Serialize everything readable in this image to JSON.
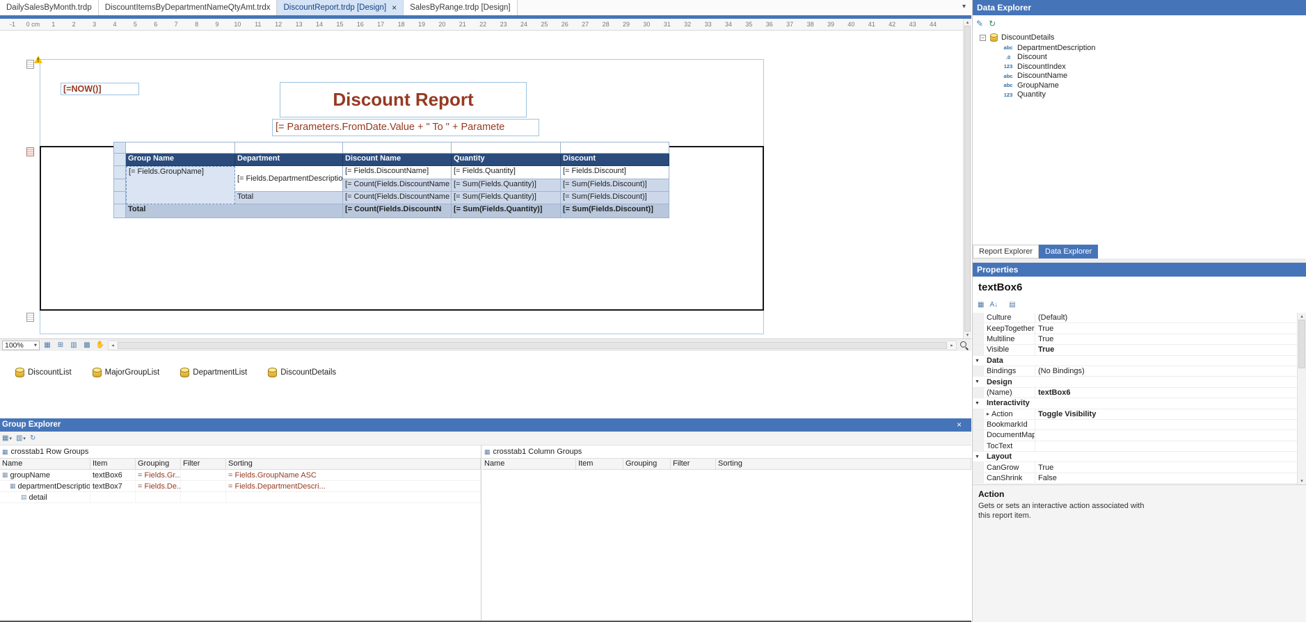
{
  "colors": {
    "panel-header": "#4674b8",
    "expr": "#953a22",
    "ct-head": "#2a4b7c",
    "warning": "#f2c200",
    "active-tab-bg": "#d4e3f6",
    "selector": "#d9e4f3",
    "light-row": "#ccd8ea",
    "grand-row": "#b9c7dc"
  },
  "icons": {
    "close": "×",
    "dropdown": "▾",
    "left_arrow": "◂",
    "right_arrow": "▸",
    "up_arrow": "▴",
    "down_arrow": "▾",
    "minus": "−",
    "refresh": "↻",
    "edit": "✎",
    "hand": "✋",
    "grid": "▦",
    "snap_grid": "⊞",
    "snap_lines": "▥",
    "watermark": "▩",
    "categorized": "▦",
    "alphabetical": "A↓",
    "property_pages": "▤",
    "cat_arrow": "▼",
    "expander": "▸"
  },
  "tabs": [
    {
      "label": "DailySalesByMonth.trdp",
      "active": false
    },
    {
      "label": "DiscountItemsByDepartmentNameQtyAmt.trdx",
      "active": false
    },
    {
      "label": "DiscountReport.trdp [Design]",
      "active": true
    },
    {
      "label": "SalesByRange.trdp [Design]",
      "active": false
    }
  ],
  "ruler": {
    "start": -1,
    "end": 44,
    "unit": "cm"
  },
  "design": {
    "now_expression": "[=NOW()]",
    "title": "Discount Report",
    "subtitle": "[= Parameters.FromDate.Value + \"   To   \" + Paramete",
    "crosstab": {
      "col_headers": [
        "Group Name",
        "Department",
        "Discount Name",
        "Quantity",
        "Discount"
      ],
      "group_cell": "[= Fields.GroupName]",
      "department_cell": "[= Fields.DepartmentDescription]",
      "detail_row": [
        "[= Fields.DiscountName]",
        "[= Fields.Quantity]",
        "[= Fields.Discount]"
      ],
      "dept_total_row": [
        "[= Count(Fields.DiscountName",
        "[= Sum(Fields.Quantity)]",
        "[= Sum(Fields.Discount)]"
      ],
      "group_total_label": "Total",
      "group_total_row": [
        "[= Count(Fields.DiscountName",
        "[= Sum(Fields.Quantity)]",
        "[= Sum(Fields.Discount)]"
      ],
      "grand_total_label": "Total",
      "grand_total_row": [
        "[= Count(Fields.DiscountN",
        "[= Sum(Fields.Quantity)]",
        "[= Sum(Fields.Discount)]"
      ]
    }
  },
  "statusbar": {
    "zoom": "100%"
  },
  "components": [
    {
      "label": "DiscountList"
    },
    {
      "label": "MajorGroupList"
    },
    {
      "label": "DepartmentList"
    },
    {
      "label": "DiscountDetails"
    }
  ],
  "group_explorer": {
    "title": "Group Explorer",
    "row_pane": {
      "title": "crosstab1 Row Groups",
      "columns": [
        "Name",
        "Item",
        "Grouping",
        "Filter",
        "Sorting"
      ],
      "rows": [
        {
          "name": "groupName",
          "item": "textBox6",
          "grouping": "= Fields.Gr...",
          "filter": "",
          "sorting": "= Fields.GroupName ASC"
        },
        {
          "name": "departmentDescription",
          "item": "textBox7",
          "grouping": "= Fields.De...",
          "filter": "",
          "sorting": "= Fields.DepartmentDescri..."
        },
        {
          "name": "detail",
          "item": "",
          "grouping": "",
          "filter": "",
          "sorting": ""
        }
      ]
    },
    "column_pane": {
      "title": "crosstab1 Column Groups",
      "columns": [
        "Name",
        "Item",
        "Grouping",
        "Filter",
        "Sorting"
      ],
      "rows": []
    }
  },
  "data_explorer": {
    "title": "Data Explorer",
    "root_label": "DiscountDetails",
    "fields": [
      {
        "label": "DepartmentDescription",
        "icon": "abc"
      },
      {
        "label": "Discount",
        "icon": ".0"
      },
      {
        "label": "DiscountIndex",
        "icon": "123"
      },
      {
        "label": "DiscountName",
        "icon": "abc"
      },
      {
        "label": "GroupName",
        "icon": "abc"
      },
      {
        "label": "Quantity",
        "icon": "123"
      }
    ],
    "tabs": [
      {
        "label": "Report Explorer",
        "active": false
      },
      {
        "label": "Data Explorer",
        "active": true
      }
    ]
  },
  "properties": {
    "panel_title": "Properties",
    "object_name": "textBox6",
    "rows": [
      {
        "name": "Culture",
        "value": "(Default)"
      },
      {
        "name": "KeepTogether",
        "value": "True"
      },
      {
        "name": "Multiline",
        "value": "True"
      },
      {
        "name": "Visible",
        "value": "True",
        "bold": true
      },
      {
        "name": "Data",
        "is_category": true
      },
      {
        "name": "Bindings",
        "value": "(No Bindings)"
      },
      {
        "name": "Design",
        "is_category": true
      },
      {
        "name": "(Name)",
        "value": "textBox6",
        "bold": true
      },
      {
        "name": "Interactivity",
        "is_category": true
      },
      {
        "name": "Action",
        "value": "Toggle Visibility",
        "bold": true,
        "expander": true
      },
      {
        "name": "BookmarkId",
        "value": ""
      },
      {
        "name": "DocumentMap",
        "value": ""
      },
      {
        "name": "TocText",
        "value": ""
      },
      {
        "name": "Layout",
        "is_category": true
      },
      {
        "name": "CanGrow",
        "value": "True"
      },
      {
        "name": "CanShrink",
        "value": "False"
      }
    ],
    "description": {
      "title": "Action",
      "text": "Gets or sets an interactive action associated with this report item."
    }
  }
}
